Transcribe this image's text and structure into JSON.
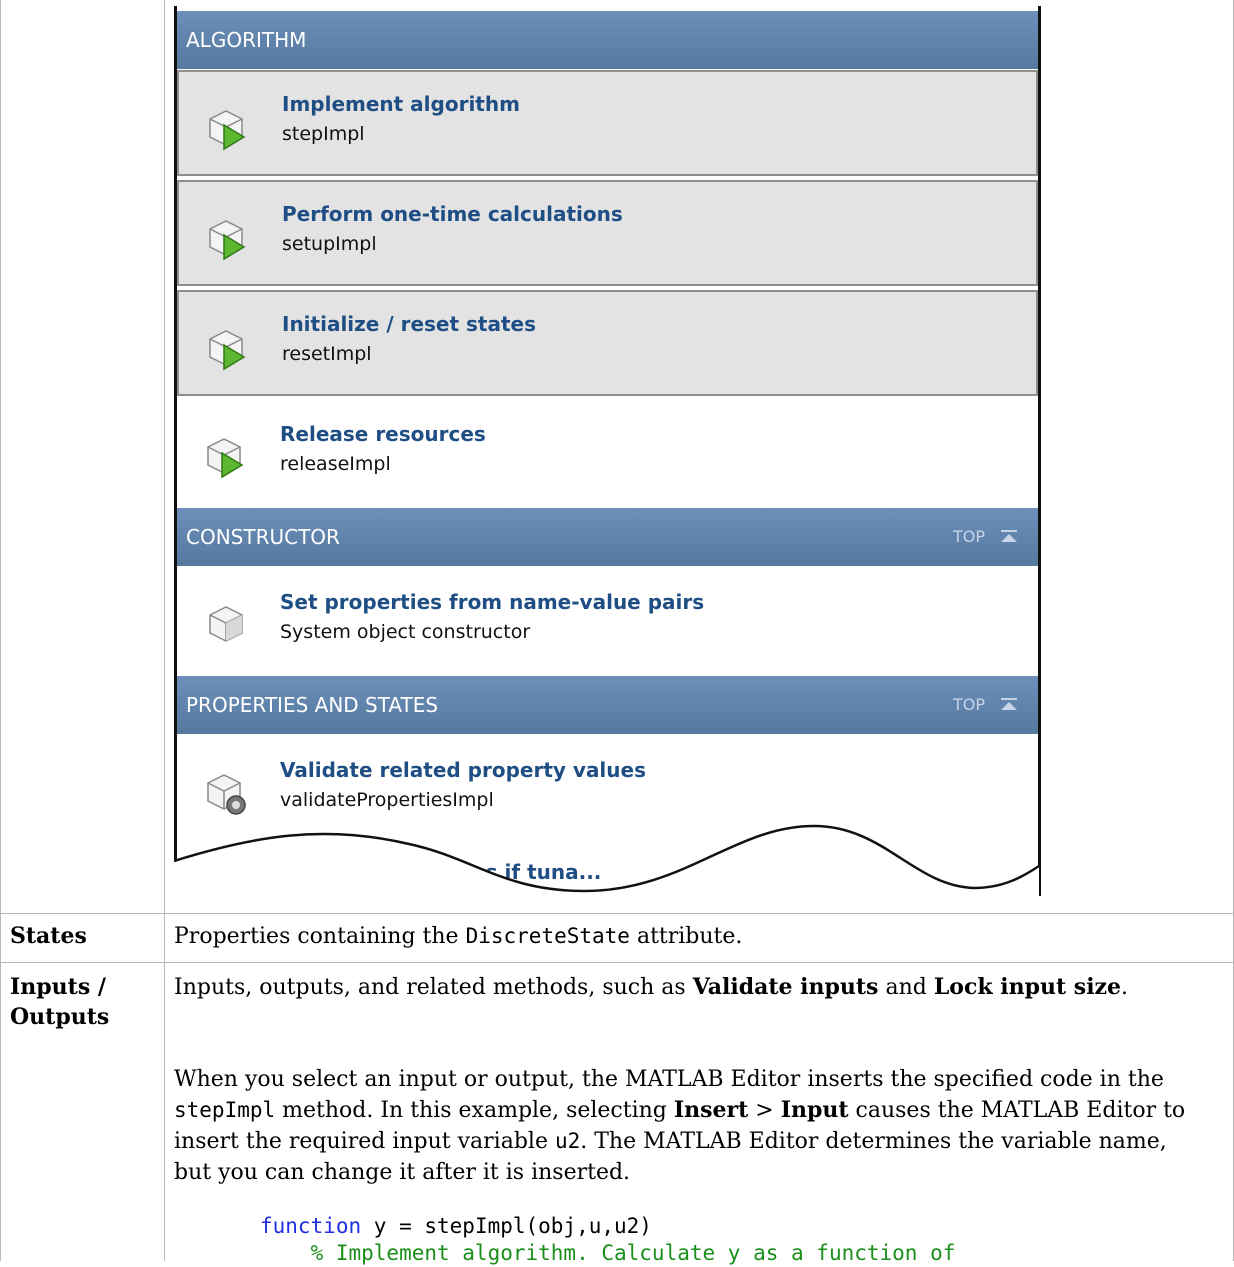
{
  "panel": {
    "sections": [
      {
        "title": "ALGORITHM",
        "items": [
          {
            "label": "Implement algorithm",
            "sub": "stepImpl"
          },
          {
            "label": "Perform one-time calculations",
            "sub": "setupImpl"
          },
          {
            "label": "Initialize / reset states",
            "sub": "resetImpl"
          },
          {
            "label": "Release resources",
            "sub": "releaseImpl"
          }
        ]
      },
      {
        "title": "CONSTRUCTOR",
        "top_label": "TOP",
        "items": [
          {
            "label": "Set properties from name-value pairs",
            "sub": "System object constructor"
          }
        ]
      },
      {
        "title": "PROPERTIES AND STATES",
        "top_label": "TOP",
        "items": [
          {
            "label": "Validate related property values",
            "sub": "validatePropertiesImpl"
          },
          {
            "label": "...ations if tuna..."
          }
        ]
      }
    ]
  },
  "rows": {
    "states": {
      "heading": "States",
      "text_pre": "Properties containing the ",
      "text_code": "DiscreteState",
      "text_post": " attribute."
    },
    "io": {
      "heading_line1": "Inputs /",
      "heading_line2": "Outputs",
      "p1_pre": "Inputs, outputs, and related methods, such as ",
      "p1_bold1": "Validate inputs",
      "p1_mid": " and ",
      "p1_bold2": "Lock input size",
      "p1_post": ".",
      "p2_a": "When you select an input or output, the MATLAB Editor inserts the specified code in the ",
      "p2_code1": "stepImpl",
      "p2_b": " method. In this example, selecting ",
      "p2_bold1": "Insert",
      "p2_c": " > ",
      "p2_bold2": "Input",
      "p2_d": " causes the MATLAB Editor to insert the required input variable ",
      "p2_code2": "u2",
      "p2_e": ". The MATLAB Editor determines the variable name, but you can change it after it is inserted.",
      "code_kw": "function",
      "code_line1_rest": " y = stepImpl(obj,u,u2)",
      "code_line2": "    % Implement algorithm. Calculate y as a function of"
    }
  }
}
